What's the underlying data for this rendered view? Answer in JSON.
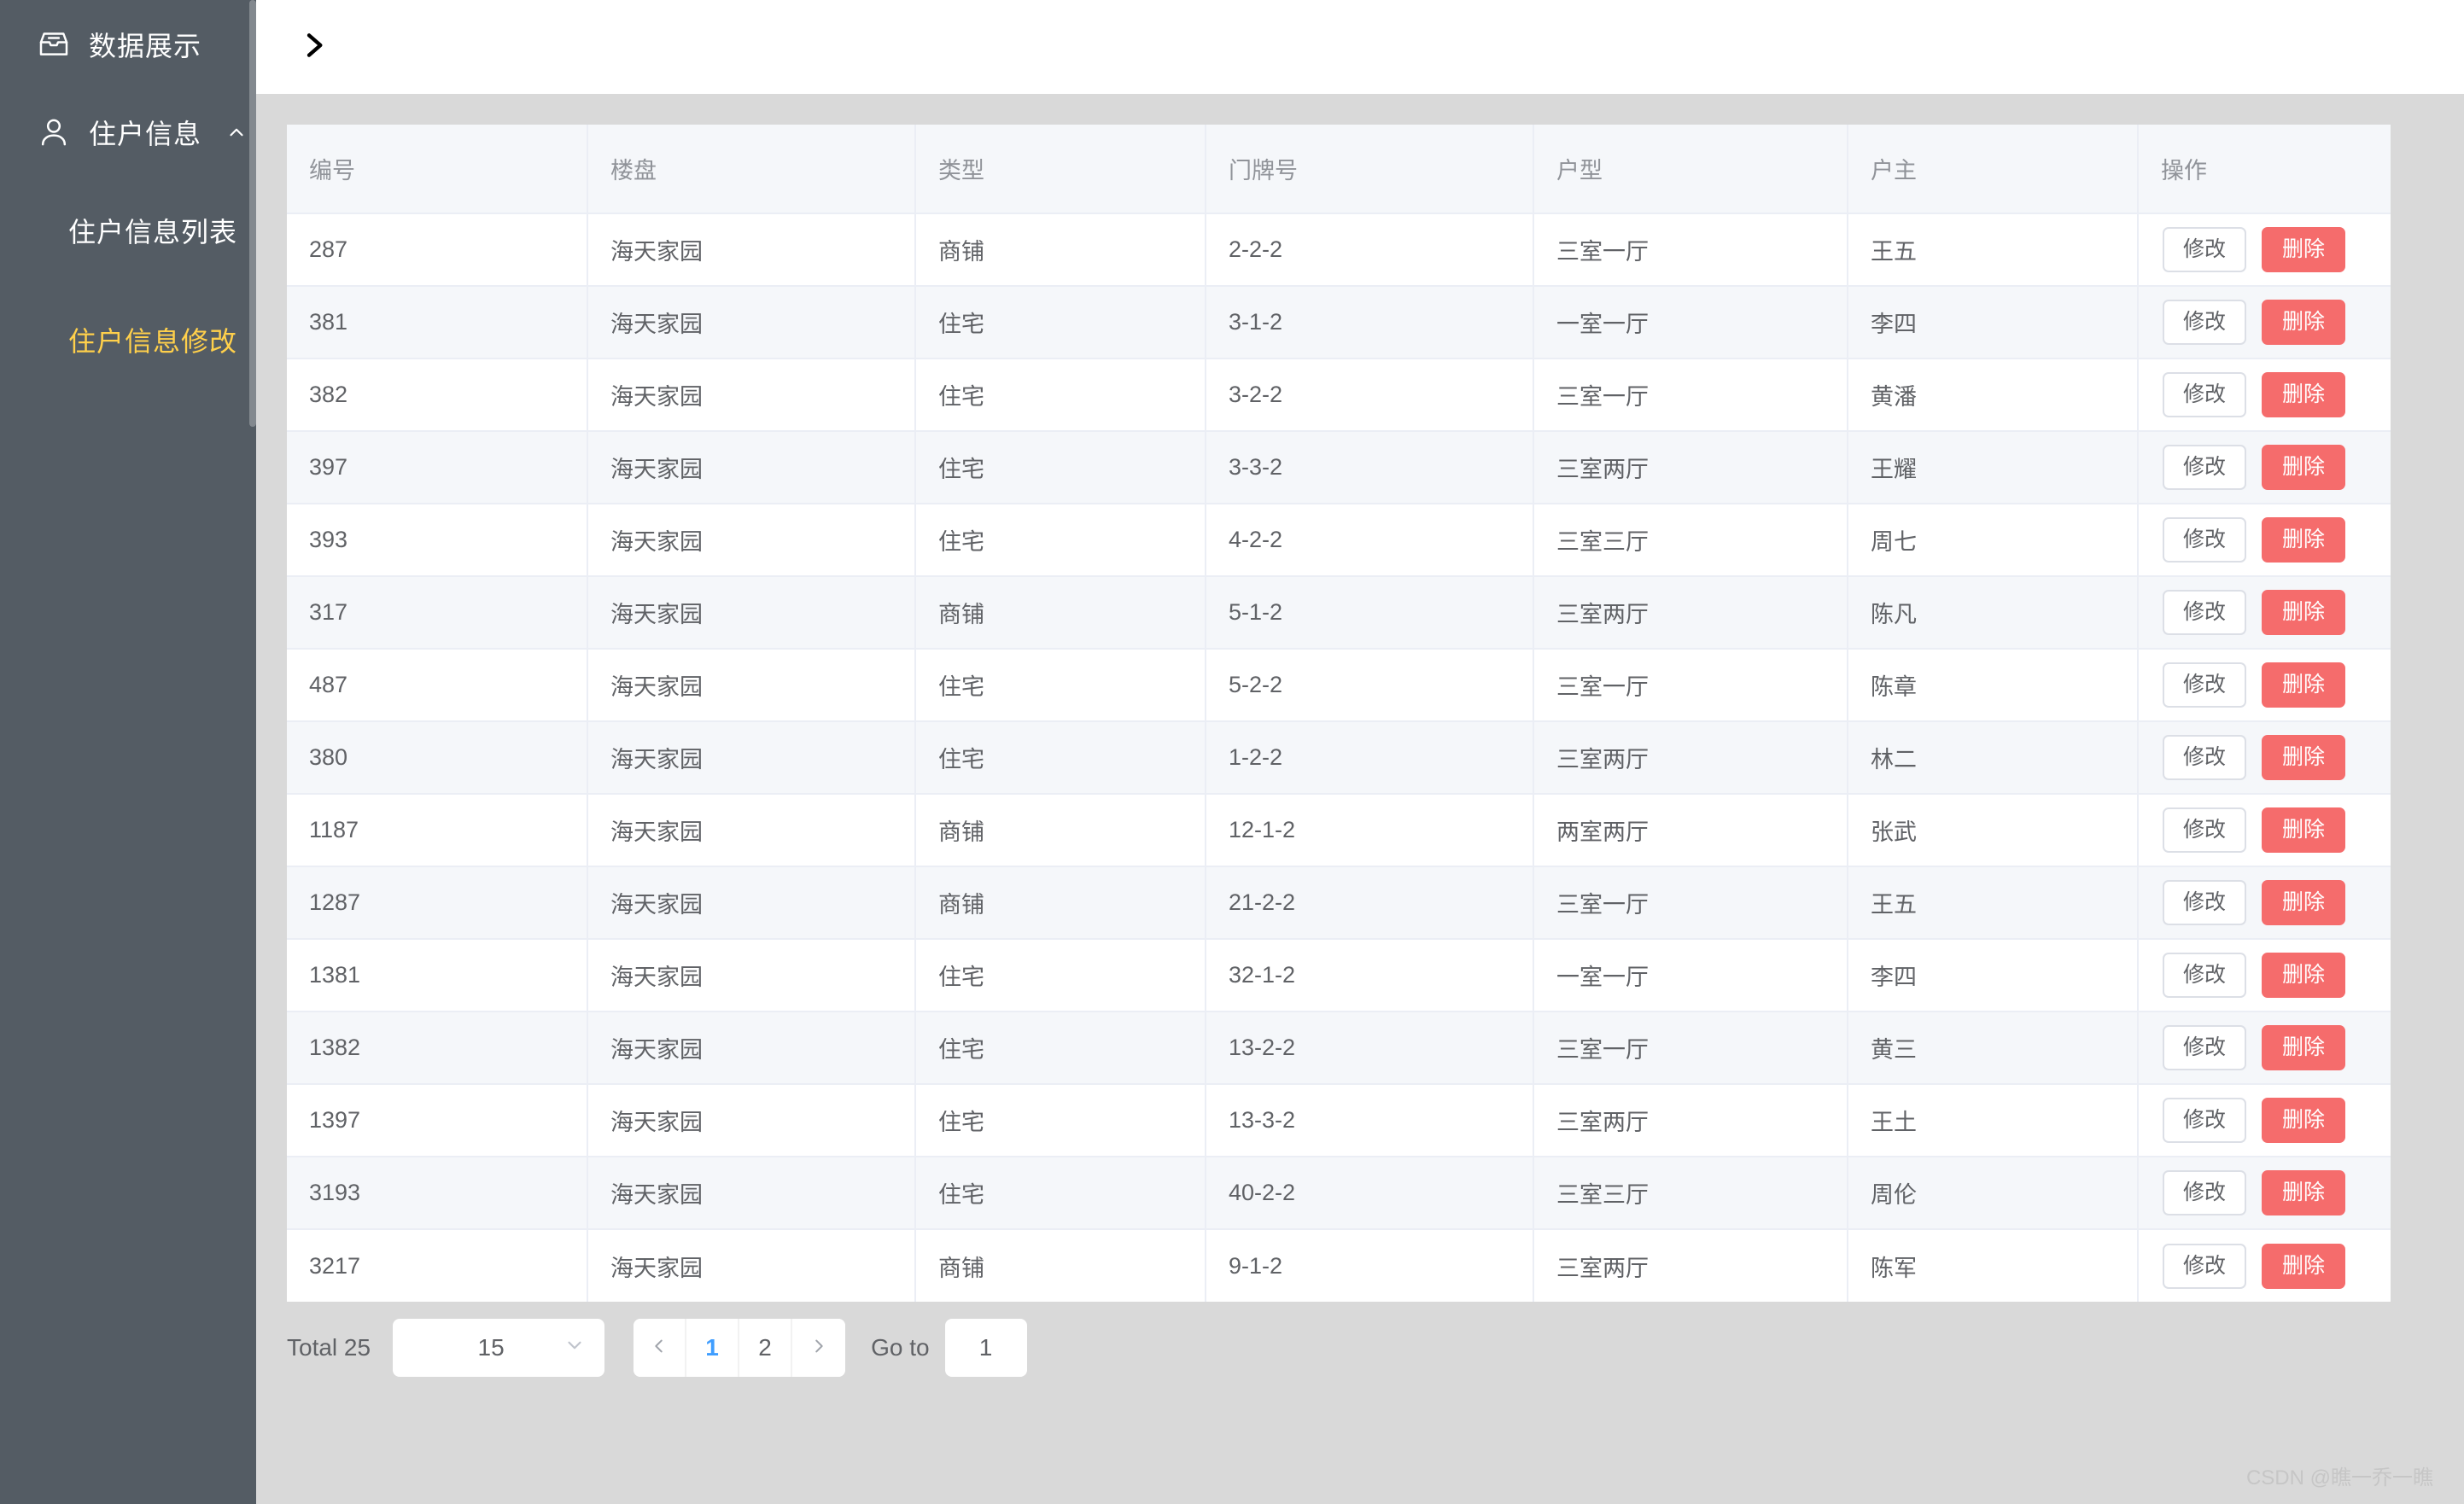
{
  "sidebar": {
    "background_color": "#545c64",
    "active_color": "#ffd04b",
    "items": [
      {
        "label": "数据展示",
        "icon": "inbox-icon"
      },
      {
        "label": "住户信息",
        "icon": "user-icon",
        "arrow": "chevron-up-icon"
      }
    ],
    "submenu": [
      {
        "label": "住户信息列表",
        "active": false
      },
      {
        "label": "住户信息修改",
        "active": true
      }
    ]
  },
  "topbar": {
    "toggle_icon": "chevron-right-icon"
  },
  "table": {
    "columns": [
      {
        "key": "id",
        "label": "编号"
      },
      {
        "key": "estate",
        "label": "楼盘"
      },
      {
        "key": "type",
        "label": "类型"
      },
      {
        "key": "door",
        "label": "门牌号"
      },
      {
        "key": "layout",
        "label": "户型"
      },
      {
        "key": "owner",
        "label": "户主"
      },
      {
        "key": "ops",
        "label": "操作"
      }
    ],
    "row_actions": {
      "edit_label": "修改",
      "delete_label": "删除",
      "delete_color": "#f56c6c"
    },
    "rows": [
      {
        "id": "287",
        "estate": "海天家园",
        "type": "商铺",
        "door": "2-2-2",
        "layout": "三室一厅",
        "owner": "王五"
      },
      {
        "id": "381",
        "estate": "海天家园",
        "type": "住宅",
        "door": "3-1-2",
        "layout": "一室一厅",
        "owner": "李四"
      },
      {
        "id": "382",
        "estate": "海天家园",
        "type": "住宅",
        "door": "3-2-2",
        "layout": "三室一厅",
        "owner": "黄潘"
      },
      {
        "id": "397",
        "estate": "海天家园",
        "type": "住宅",
        "door": "3-3-2",
        "layout": "三室两厅",
        "owner": "王耀"
      },
      {
        "id": "393",
        "estate": "海天家园",
        "type": "住宅",
        "door": "4-2-2",
        "layout": "三室三厅",
        "owner": "周七"
      },
      {
        "id": "317",
        "estate": "海天家园",
        "type": "商铺",
        "door": "5-1-2",
        "layout": "三室两厅",
        "owner": "陈凡"
      },
      {
        "id": "487",
        "estate": "海天家园",
        "type": "住宅",
        "door": "5-2-2",
        "layout": "三室一厅",
        "owner": "陈章"
      },
      {
        "id": "380",
        "estate": "海天家园",
        "type": "住宅",
        "door": "1-2-2",
        "layout": "三室两厅",
        "owner": "林二"
      },
      {
        "id": "1187",
        "estate": "海天家园",
        "type": "商铺",
        "door": "12-1-2",
        "layout": "两室两厅",
        "owner": "张武"
      },
      {
        "id": "1287",
        "estate": "海天家园",
        "type": "商铺",
        "door": "21-2-2",
        "layout": "三室一厅",
        "owner": "王五"
      },
      {
        "id": "1381",
        "estate": "海天家园",
        "type": "住宅",
        "door": "32-1-2",
        "layout": "一室一厅",
        "owner": "李四"
      },
      {
        "id": "1382",
        "estate": "海天家园",
        "type": "住宅",
        "door": "13-2-2",
        "layout": "三室一厅",
        "owner": "黄三"
      },
      {
        "id": "1397",
        "estate": "海天家园",
        "type": "住宅",
        "door": "13-3-2",
        "layout": "三室两厅",
        "owner": "王土"
      },
      {
        "id": "3193",
        "estate": "海天家园",
        "type": "住宅",
        "door": "40-2-2",
        "layout": "三室三厅",
        "owner": "周伦"
      },
      {
        "id": "3217",
        "estate": "海天家园",
        "type": "商铺",
        "door": "9-1-2",
        "layout": "三室两厅",
        "owner": "陈军"
      }
    ]
  },
  "pagination": {
    "total_label": "Total 25",
    "page_size": "15",
    "page_size_caret": "chevron-down-icon",
    "prev_arrow": "chevron-left-icon",
    "next_arrow": "chevron-right-icon",
    "pages": [
      "1",
      "2"
    ],
    "current_page": "1",
    "active_color": "#409eff",
    "jump_label": "Go to",
    "jump_value": "1"
  },
  "watermark": {
    "text": "CSDN @瞧一乔一瞧"
  }
}
